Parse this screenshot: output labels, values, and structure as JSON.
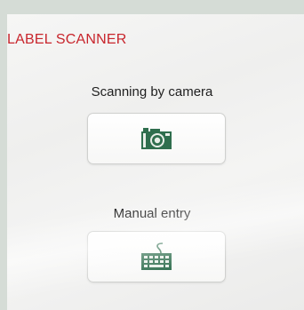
{
  "header": {
    "title": "LABEL SCANNER"
  },
  "options": {
    "camera": {
      "label": "Scanning by camera",
      "icon": "camera-icon"
    },
    "manual": {
      "label": "Manual entry",
      "icon": "keyboard-icon"
    }
  },
  "colors": {
    "title": "#c8252c",
    "icon": "#2f6e4e",
    "background": "#d5dcd6"
  }
}
